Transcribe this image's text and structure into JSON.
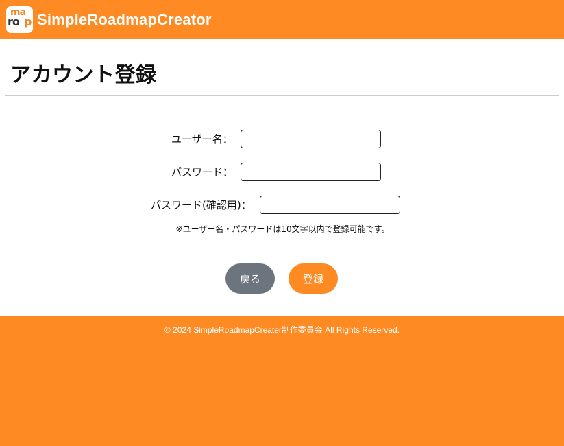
{
  "header": {
    "logo_top": "ma",
    "logo_bottom": "ro",
    "logo_accent": "p",
    "title": "SimpleRoadmapCreator"
  },
  "main": {
    "title": "アカウント登録",
    "form": {
      "username_label": "ユーザー名：",
      "username_value": "",
      "password_label": "パスワード：",
      "password_value": "",
      "confirm_label": "パスワード(確認用)：",
      "confirm_value": "",
      "note": "※ユーザー名・パスワードは10文字以内で登録可能です。"
    },
    "buttons": {
      "back_label": "戻る",
      "register_label": "登録"
    }
  },
  "footer": {
    "copyright": "© 2024 SimpleRoadmapCreater制作委員会 All Rights Reserved."
  },
  "colors": {
    "brand_orange": "#fe8a23",
    "back_button_gray": "#6c757d",
    "divider_gray": "#cccccc"
  }
}
